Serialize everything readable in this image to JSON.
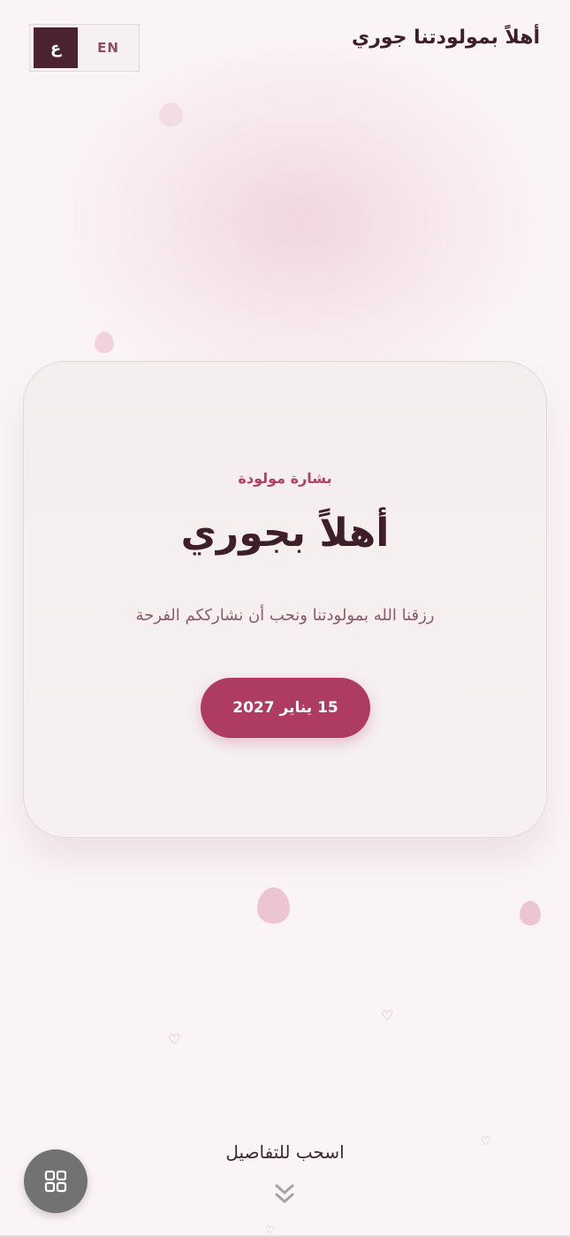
{
  "header": {
    "title": "أهلاً بمولودتنا جوري",
    "lang_active": "ع",
    "lang_other": "EN"
  },
  "card": {
    "eyebrow": "بشارة مولودة",
    "title": "أهلاً بجوري",
    "subtitle": "رزقنا الله بمولودتنا ونحب أن نشارككم الفرحة",
    "date_button": "15 يناير 2027"
  },
  "footer": {
    "swipe_hint": "اسحب للتفاصيل",
    "menu_icon": "grid-icon",
    "chevron_icon": "double-chevron-down-icon"
  },
  "colors": {
    "accent": "#ad3b62",
    "dark": "#4a2230",
    "background": "#fbf4f6"
  }
}
